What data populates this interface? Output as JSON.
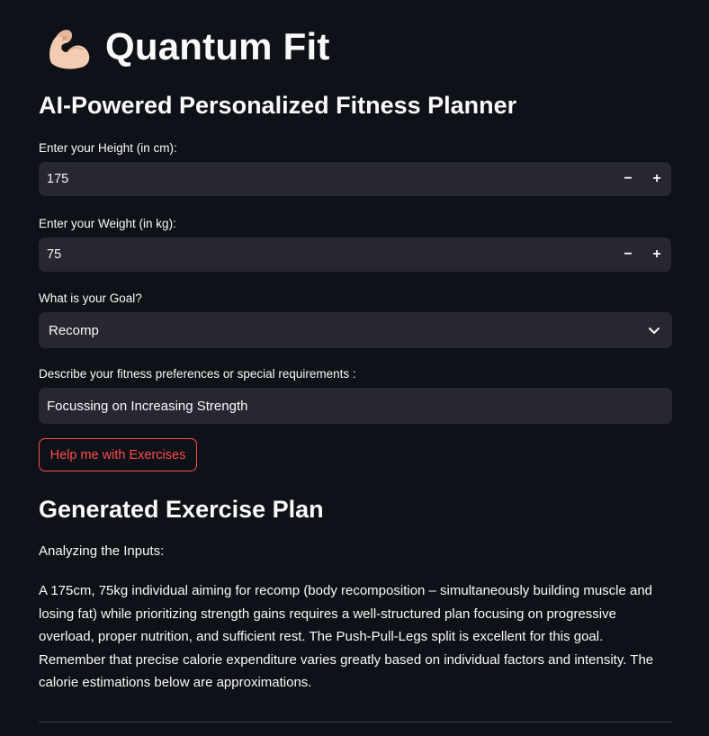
{
  "header": {
    "icon": "flexed-biceps-emoji",
    "title": "Quantum Fit"
  },
  "subtitle": "AI-Powered Personalized Fitness Planner",
  "form": {
    "height": {
      "label": "Enter your Height (in cm):",
      "value": "175",
      "minus": "−",
      "plus": "+"
    },
    "weight": {
      "label": "Enter your Weight (in kg):",
      "value": "75",
      "minus": "−",
      "plus": "+"
    },
    "goal": {
      "label": "What is your Goal?",
      "selected": "Recomp"
    },
    "preferences": {
      "label": "Describe your fitness preferences or special requirements :",
      "value": "Focussing on Increasing Strength"
    },
    "submit_label": "Help me with Exercises"
  },
  "result": {
    "heading": "Generated Exercise Plan",
    "intro": "Analyzing the Inputs:",
    "body": "A 175cm, 75kg individual aiming for recomp (body recomposition – simultaneously building muscle and losing fat) while prioritizing strength gains requires a well-structured plan focusing on progressive overload, proper nutrition, and sufficient rest. The Push-Pull-Legs split is excellent for this goal. Remember that precise calorie expenditure varies greatly based on individual factors and intensity. The calorie estimations below are approximations."
  },
  "colors": {
    "background": "#0e1117",
    "input_bg": "#262730",
    "text": "#fafafa",
    "accent": "#ff4b4b"
  }
}
